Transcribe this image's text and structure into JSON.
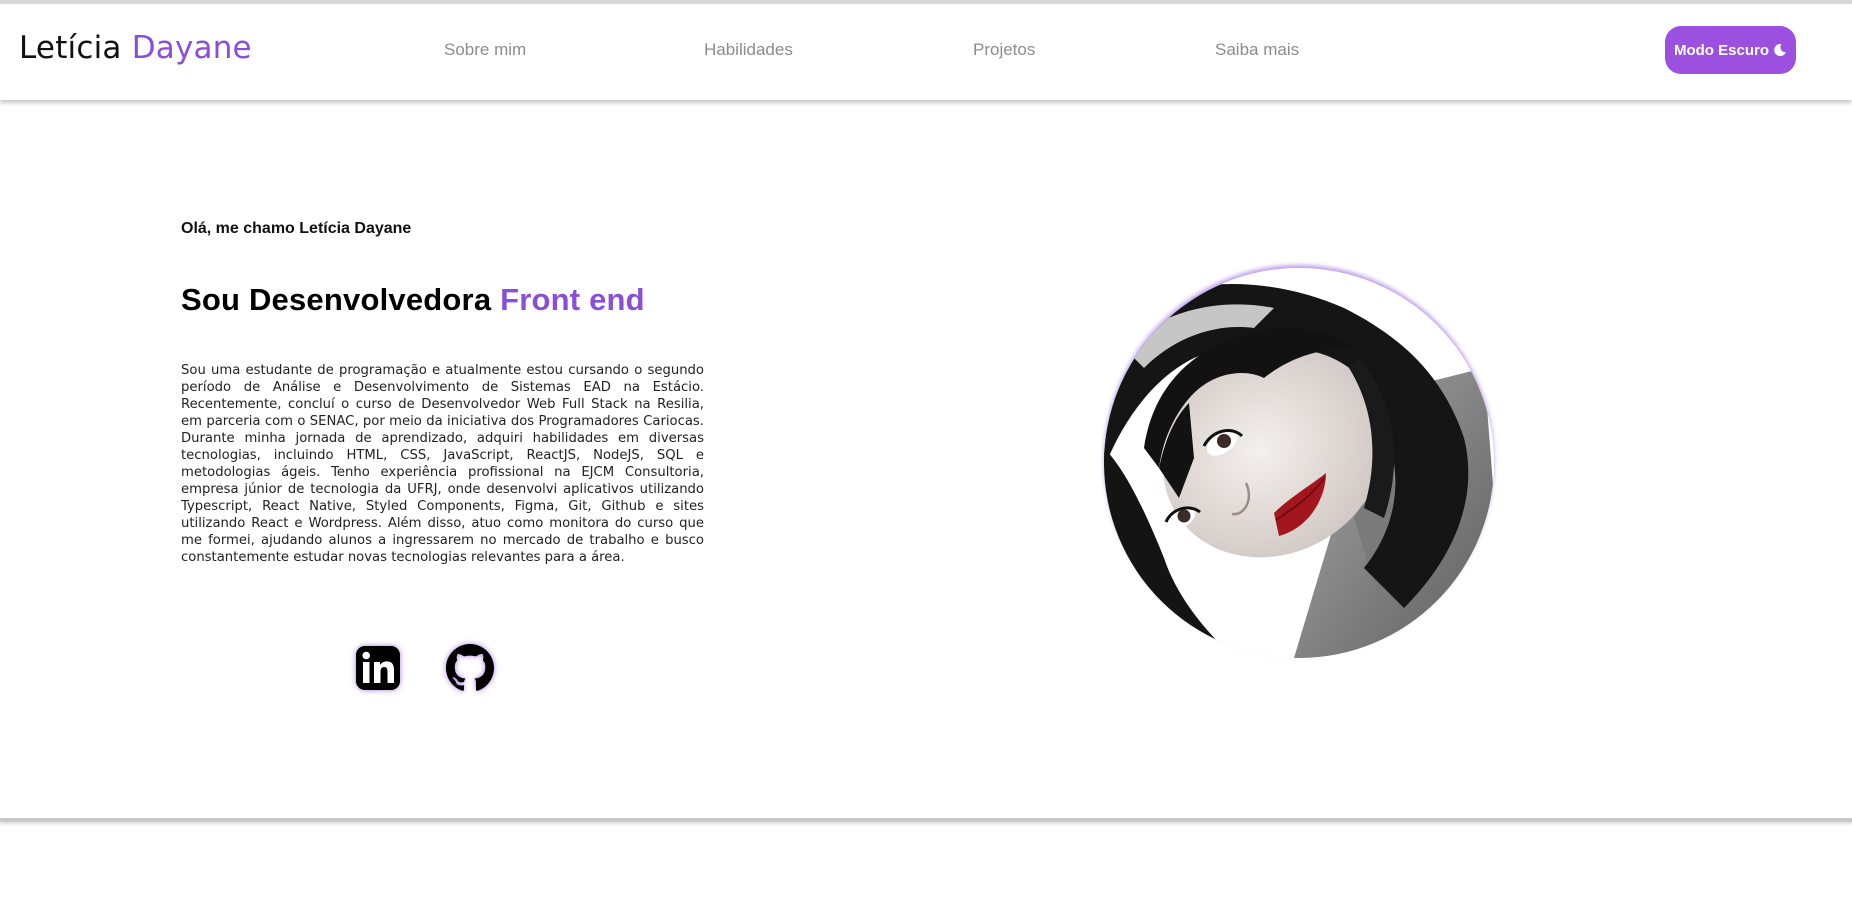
{
  "header": {
    "logo_first": "Letícia",
    "logo_second": "Dayane",
    "nav": [
      "Sobre mim",
      "Habilidades",
      "Projetos",
      "Saiba mais"
    ],
    "mode_button": "Modo Escuro",
    "mode_icon": "moon-icon"
  },
  "hero": {
    "greeting": "Olá, me chamo Letícia Dayane",
    "headline_prefix": "Sou Desenvolvedora",
    "headline_accent": "Front end",
    "bio": "Sou uma estudante de programação e atualmente estou cursando o segundo período de Análise e Desenvolvimento de Sistemas EAD na Estácio. Recentemente, concluí o curso de Desenvolvedor Web Full Stack na Resilia, em parceria com o SENAC, por meio da iniciativa dos Programadores Cariocas. Durante minha jornada de aprendizado, adquiri habilidades em diversas tecnologias, incluindo HTML, CSS, JavaScript, ReactJS, NodeJS, SQL e metodologias ágeis. Tenho experiência profissional na EJCM Consultoria, empresa júnior de tecnologia da UFRJ, onde desenvolvi aplicativos utilizando Typescript, React Native, Styled Components, Figma, Git, Github e sites utilizando React e Wordpress. Além disso, atuo como monitora do curso que me formei, ajudando alunos a ingressarem no mercado de trabalho e busco constantemente estudar novas tecnologias relevantes para a área.",
    "social_icons": [
      "linkedin-icon",
      "github-icon"
    ]
  },
  "colors": {
    "accent": "#8a4fd8",
    "button": "#9b50e0",
    "nav_text": "#8c8c8c"
  }
}
